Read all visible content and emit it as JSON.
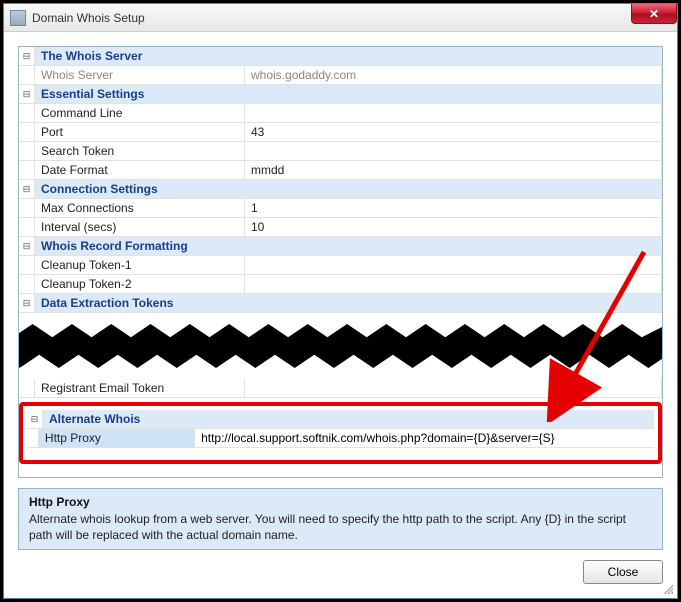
{
  "window": {
    "title": "Domain Whois Setup",
    "close_btn_glyph": "✕"
  },
  "sections": {
    "whois_server": {
      "title": "The Whois Server",
      "rows": {
        "server": {
          "label": "Whois Server",
          "value": "whois.godaddy.com"
        }
      }
    },
    "essential": {
      "title": "Essential Settings",
      "rows": {
        "cmd": {
          "label": "Command Line",
          "value": ""
        },
        "port": {
          "label": "Port",
          "value": "43"
        },
        "token": {
          "label": "Search Token",
          "value": ""
        },
        "date": {
          "label": "Date Format",
          "value": "mmdd"
        }
      }
    },
    "connection": {
      "title": "Connection Settings",
      "rows": {
        "max": {
          "label": "Max Connections",
          "value": "1"
        },
        "interval": {
          "label": "Interval (secs)",
          "value": "10"
        }
      }
    },
    "formatting": {
      "title": "Whois Record Formatting",
      "rows": {
        "c1": {
          "label": "Cleanup Token-1",
          "value": ""
        },
        "c2": {
          "label": "Cleanup Token-2",
          "value": ""
        }
      }
    },
    "extraction": {
      "title": "Data Extraction Tokens",
      "rows": {
        "reg_email": {
          "label": "Registrant Email Token",
          "value": ""
        }
      }
    },
    "alternate": {
      "title": "Alternate Whois",
      "rows": {
        "proxy": {
          "label": "Http Proxy",
          "value": "http://local.support.softnik.com/whois.php?domain={D}&server={S}"
        }
      }
    }
  },
  "description": {
    "title": "Http Proxy",
    "body": "Alternate whois lookup from a web server. You will need to specify the http path to the script. Any {D} in the script path will be replaced with the actual domain name."
  },
  "buttons": {
    "close": "Close"
  },
  "annotation": {
    "arrow_color": "#e40000"
  }
}
